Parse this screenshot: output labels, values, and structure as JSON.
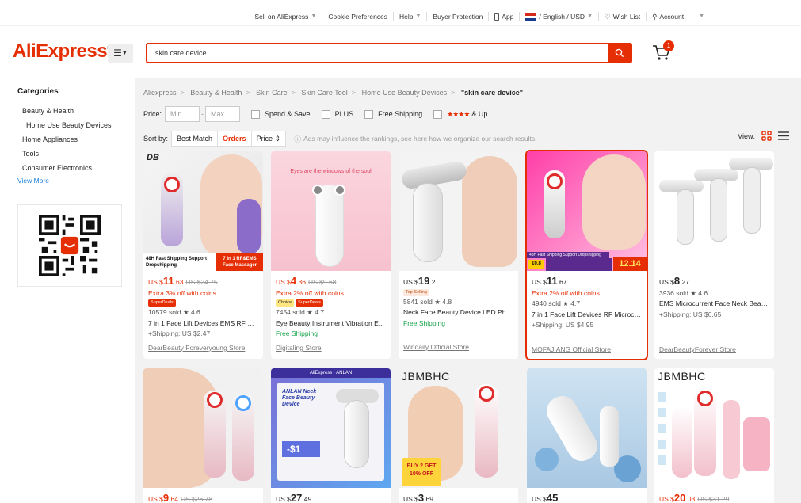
{
  "topbar": {
    "sell": "Sell on AliExpress",
    "cookies": "Cookie Preferences",
    "help": "Help",
    "protection": "Buyer Protection",
    "app": "App",
    "locale": "/ English / USD",
    "wishlist": "Wish List",
    "account": "Account"
  },
  "header": {
    "logo": "AliExpress",
    "search_value": "skin care device",
    "cart_count": "1"
  },
  "sidebar": {
    "title": "Categories",
    "items": [
      "Beauty & Health",
      "Home Use Beauty Devices",
      "Home Appliances",
      "Tools",
      "Consumer Electronics"
    ],
    "view_more": "View More"
  },
  "breadcrumb": [
    "Aliexpress",
    "Beauty & Health",
    "Skin Care",
    "Skin Care Tool",
    "Home Use Beauty Devices",
    "\"skin care device\""
  ],
  "filters": {
    "price_label": "Price:",
    "min": "Min.",
    "max": "Max",
    "spend_save": "Spend & Save",
    "plus": "PLUS",
    "free_shipping": "Free Shipping",
    "stars": "★★★★",
    "and_up": "& Up"
  },
  "sort": {
    "label": "Sort by:",
    "best": "Best Match",
    "orders": "Orders",
    "price": "Price ⇕",
    "note": "Ads may influence the rankings, see here how we organize our search results.",
    "view": "View:"
  },
  "products": [
    {
      "cur": "US $",
      "int": "11",
      "dec": ".63",
      "orig": "US $24.75",
      "coins": "Extra 3% off with coins",
      "badges": [
        "SuperDeals"
      ],
      "sold": "10579 sold",
      "rating": "★ 4.6",
      "title": "7 in 1 Face Lift Devices EMS RF Mic...",
      "ship": "+Shipping: US $2.47",
      "store": "DearBeauty Foreveryoung Store",
      "overlay1": "48H Fast Shipping Support Dropshipping",
      "overlay2": "7 in 1 RF&EMS Face Massager",
      "brand": "DB"
    },
    {
      "cur": "US $",
      "int": "4",
      "dec": ".36",
      "orig": "US $9.68",
      "coins": "Extra 2% off with coins",
      "badges": [
        "Choice",
        "SuperDeals"
      ],
      "sold": "7454 sold",
      "rating": "★ 4.7",
      "title": "Eye Beauty Instrument Vibration E...",
      "ship": "Free Shipping",
      "store": "Digitaling Store",
      "overlay1": "Eyes are the windows of the soul"
    },
    {
      "cur": "US $",
      "int": "19",
      "dec": ".2",
      "orig": "",
      "coins": "",
      "badges": [
        "Top Selling"
      ],
      "sold": "5841 sold",
      "rating": "★ 4.8",
      "title": "Neck Face Beauty Device LED Phot...",
      "ship": "Free Shipping",
      "store": "Windaily Official Store"
    },
    {
      "cur": "US $",
      "int": "11",
      "dec": ".67",
      "orig": "",
      "coins": "Extra 2% off with coins",
      "badges": [],
      "sold": "4940 sold",
      "rating": "★ 4.7",
      "title": "7 in 1 Face Lift Devices RF Microcu...",
      "ship": "+Shipping: US $4.95",
      "store": "MOFAJIANG Official Store",
      "overlay1": "48H Fast Shipping Support Dropshipping",
      "overlay2": "12.14",
      "overlay3": "€0.8"
    },
    {
      "cur": "US $",
      "int": "8",
      "dec": ".27",
      "orig": "",
      "coins": "",
      "badges": [],
      "sold": "3936 sold",
      "rating": "★ 4.6",
      "title": "EMS Microcurrent Face Neck Beau...",
      "ship": "+Shipping: US $6.65",
      "store": "DearBeautyForever Store"
    },
    {
      "cur": "US $",
      "int": "9",
      "dec": ".64",
      "orig": "US $26.78"
    },
    {
      "cur": "US $",
      "int": "27",
      "dec": ".49",
      "orig": "",
      "overlay1": "ANLAN Neck Face Beauty Device",
      "overlay2": "AliExpress · ANLAN",
      "overlay3": "-$1"
    },
    {
      "cur": "US $",
      "int": "3",
      "dec": ".69",
      "orig": "",
      "overlay1": "JBMBHC",
      "overlay2": "BUY 2 GET 10% OFF"
    },
    {
      "cur": "US $",
      "int": "45",
      "dec": "",
      "orig": ""
    },
    {
      "cur": "US $",
      "int": "20",
      "dec": ".03",
      "orig": "US $31.29",
      "overlay1": "JBMBHC"
    }
  ]
}
